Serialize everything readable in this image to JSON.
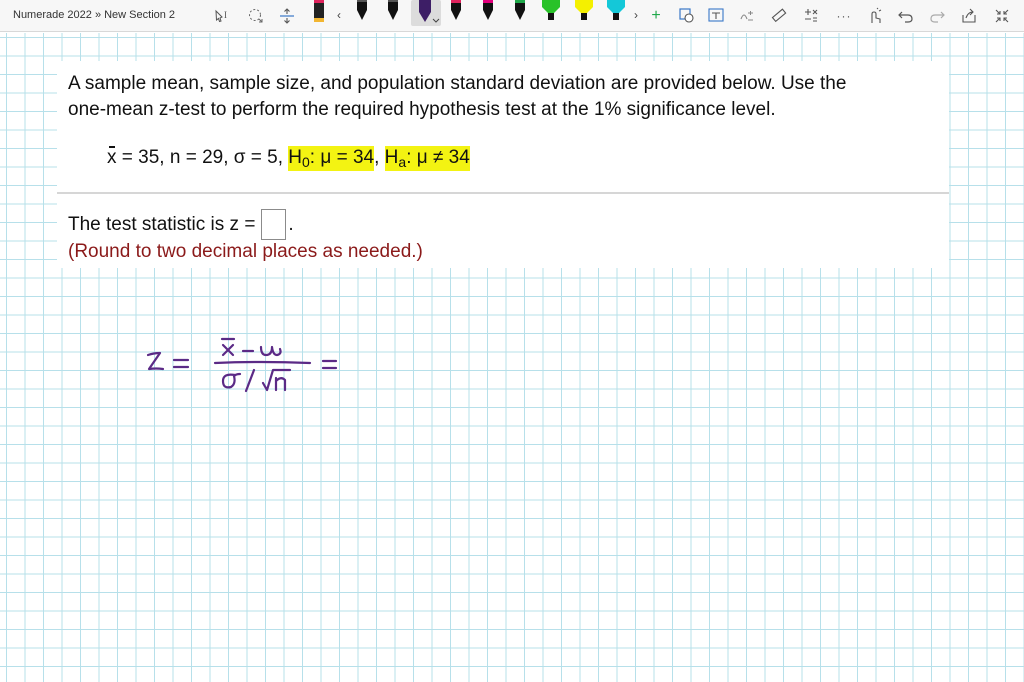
{
  "toolbar": {
    "breadcrumb": "Numerade 2022 » New Section 2",
    "tool_icons": [
      "text-select-icon",
      "lasso-icon",
      "insert-space-icon"
    ],
    "pens": [
      {
        "name": "pen-black",
        "color": "#111111"
      },
      {
        "name": "pen-black-2",
        "color": "#111111"
      },
      {
        "name": "pen-black-3",
        "color": "#111111"
      },
      {
        "name": "pen-purple",
        "color": "#5b2a86",
        "selected": true
      },
      {
        "name": "pen-red",
        "color": "#e0245e"
      },
      {
        "name": "pen-pink",
        "color": "#e3007d"
      },
      {
        "name": "pen-green",
        "color": "#1fa84a"
      },
      {
        "name": "highlighter-green",
        "color": "#29c229"
      },
      {
        "name": "highlighter-yellow",
        "color": "#f4f000"
      },
      {
        "name": "highlighter-cyan",
        "color": "#14c8d8"
      }
    ],
    "right_icons": [
      "add-pen-icon",
      "ink-to-shape-icon",
      "ink-to-text-icon",
      "ink-to-math-icon",
      "ruler-icon",
      "math-icon",
      "more-icon",
      "touch-draw-icon",
      "undo-icon",
      "redo-icon",
      "share-icon",
      "fullscreen-icon"
    ],
    "more_label": "···"
  },
  "question": {
    "line1": "A sample mean, sample size, and population standard deviation are provided below. Use the",
    "line2": "one-mean z-test to perform the required hypothesis test at the 1% significance level.",
    "formula": {
      "xbar": "x",
      "rest": " = 35, n = 29, σ = 5, ",
      "h0_label": "H",
      "h0_sub": "0",
      "h0_text": ": μ = 34",
      "comma": ", ",
      "ha_label": "H",
      "ha_sub": "a",
      "ha_text": ": μ ≠ 34"
    },
    "answer_prefix": "The test statistic is z =",
    "answer_suffix": ".",
    "hint": "(Round to two decimal places as needed.)"
  },
  "colors": {
    "ink": "#5b2a86",
    "highlight": "#f3f312",
    "hint": "#8b1a1a",
    "grid": "#b7e0ea"
  }
}
